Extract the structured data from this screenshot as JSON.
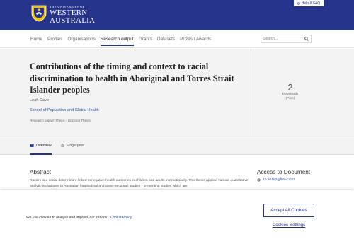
{
  "header": {
    "logo_small": "THE UNIVERSITY OF",
    "logo_line1": "WESTERN",
    "logo_line2": "AUSTRALIA",
    "help_label": "Help & FAQ",
    "brand_color": "#27348b"
  },
  "nav": {
    "items": [
      {
        "label": "Home"
      },
      {
        "label": "Profiles"
      },
      {
        "label": "Organisations"
      },
      {
        "label": "Research output",
        "active": true
      },
      {
        "label": "Grants"
      },
      {
        "label": "Datasets"
      },
      {
        "label": "Prizes / Awards"
      }
    ],
    "search_placeholder": "Search..."
  },
  "record": {
    "title": "Contributions of the timing and context to racial discrimination to health in Aboriginal and Torres Strait Islander peoples",
    "author": "Leah Cave",
    "organisation": "School of Population and Global Health",
    "meta": "Research output: Thesis › Doctoral Thesis"
  },
  "metric": {
    "value": "2",
    "label_line1": "Downloads",
    "label_line2": "(Pure)"
  },
  "tabs": [
    {
      "label": "Overview",
      "icon": "book-icon",
      "active": true
    },
    {
      "label": "Fingerprint",
      "icon": "fingerprint-icon",
      "active": false
    }
  ],
  "abstract": {
    "heading": "Abstract",
    "text": "Racism is a social determinant linked to negative health outcomes in children and adults internationally. This thesis applied various quantitative analytic techniques to Australian longitudinal and cross-sectional studies - presenting studies which are"
  },
  "access": {
    "heading": "Access to Document",
    "doi": "10.26182/gf9m-cd30"
  },
  "cookie": {
    "text": "We use cookies to analyse and improve our service.",
    "policy_link": "Cookie Policy",
    "accept_label": "Accept All Cookies",
    "settings_label": "Cookies Settings"
  }
}
